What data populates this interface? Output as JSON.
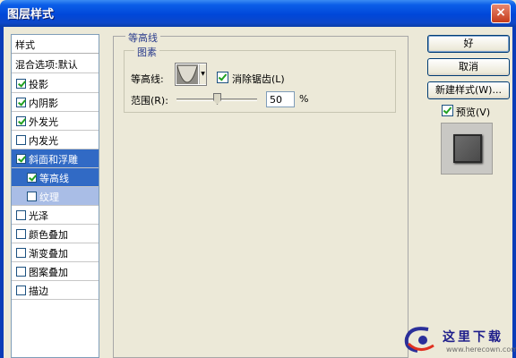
{
  "window": {
    "title": "图层样式",
    "close_glyph": "×"
  },
  "style_list": {
    "header": "样式",
    "blend_options": "混合选项:默认",
    "items": [
      {
        "label": "投影",
        "checked": true
      },
      {
        "label": "内阴影",
        "checked": true
      },
      {
        "label": "外发光",
        "checked": true
      },
      {
        "label": "内发光",
        "checked": false
      },
      {
        "label": "斜面和浮雕",
        "checked": true
      },
      {
        "label": "等高线",
        "checked": true
      },
      {
        "label": "纹理",
        "checked": false
      },
      {
        "label": "光泽",
        "checked": false
      },
      {
        "label": "颜色叠加",
        "checked": false
      },
      {
        "label": "渐变叠加",
        "checked": false
      },
      {
        "label": "图案叠加",
        "checked": false
      },
      {
        "label": "描边",
        "checked": false
      }
    ]
  },
  "contour_panel": {
    "group_title": "等高线",
    "subgroup_title": "图素",
    "contour_label": "等高线:",
    "antialias_label": "消除锯齿(L)",
    "antialias_checked": true,
    "range_label": "范围(R):",
    "range_value": "50",
    "range_unit": "%",
    "range_slider_percent": 50
  },
  "buttons": {
    "ok": "好",
    "cancel": "取消",
    "new_style": "新建样式(W)...",
    "preview_label": "预览(V)",
    "preview_checked": true
  },
  "watermark": {
    "text": "这里下载",
    "url": "www.herecown.com"
  },
  "icons": {
    "close": "close-icon",
    "checkbox": "checkmark-icon",
    "dropdown": "chevron-down-icon",
    "slider": "slider-thumb-icon"
  }
}
